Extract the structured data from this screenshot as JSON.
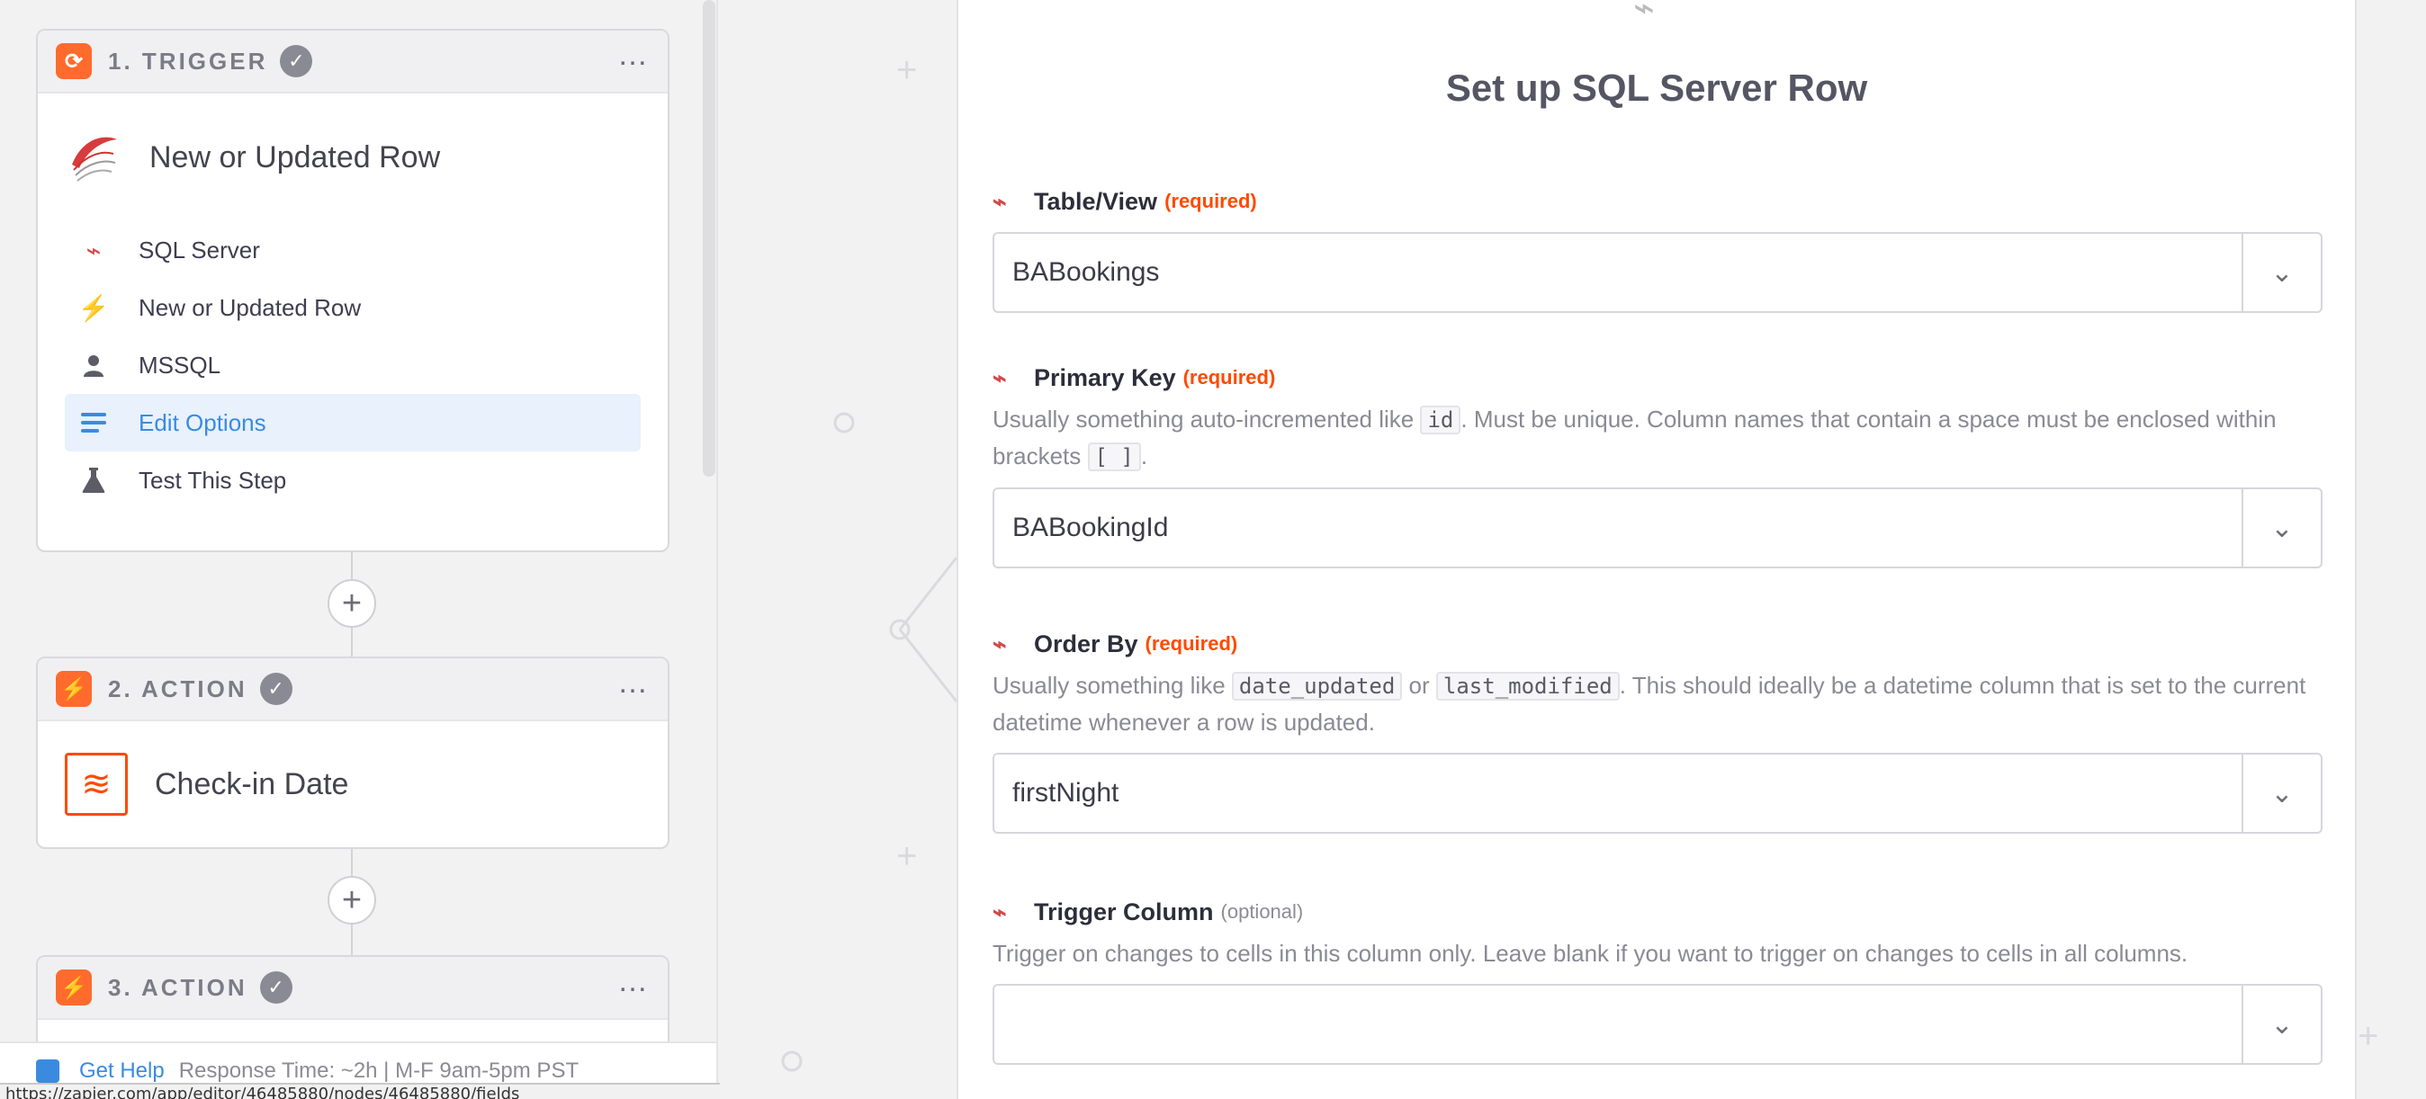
{
  "sidebar": {
    "trigger": {
      "step_label": "1. TRIGGER",
      "title": "New or Updated Row",
      "items": [
        {
          "label": "SQL Server",
          "icon": "sql-server-icon"
        },
        {
          "label": "New or Updated Row",
          "icon": "lightning-icon"
        },
        {
          "label": "MSSQL",
          "icon": "user-icon"
        },
        {
          "label": "Edit Options",
          "icon": "list-icon",
          "active": true
        },
        {
          "label": "Test This Step",
          "icon": "flask-icon"
        }
      ]
    },
    "action2": {
      "step_label": "2. ACTION",
      "title": "Check-in Date"
    },
    "action3": {
      "step_label": "3. ACTION"
    },
    "help": {
      "link": "Get Help",
      "meta": "Response Time: ~2h | M-F 9am-5pm PST"
    },
    "status_url": "https://zapier.com/app/editor/46485880/nodes/46485880/fields"
  },
  "panel": {
    "title": "Set up SQL Server Row",
    "fields": {
      "table": {
        "label": "Table/View",
        "tag": "(required)",
        "value": "BABookings"
      },
      "primary_key": {
        "label": "Primary Key",
        "tag": "(required)",
        "help_1": "Usually something auto-incremented like",
        "code_1": "id",
        "help_2": ". Must be unique. Column names that contain a space must be enclosed within brackets",
        "code_2": "[ ]",
        "help_3": ".",
        "value": "BABookingId"
      },
      "order_by": {
        "label": "Order By",
        "tag": "(required)",
        "help_1": "Usually something like",
        "code_1": "date_updated",
        "help_2": "or",
        "code_2": "last_modified",
        "help_3": ". This should ideally be a datetime column that is set to the current datetime whenever a row is updated.",
        "value": "firstNight"
      },
      "trigger_column": {
        "label": "Trigger Column",
        "tag": "(optional)",
        "help": "Trigger on changes to cells in this column only. Leave blank if you want to trigger on changes to cells in all columns.",
        "value": ""
      }
    }
  },
  "colors": {
    "accent_orange": "#ff4a00",
    "active_blue": "#3a8be0"
  }
}
